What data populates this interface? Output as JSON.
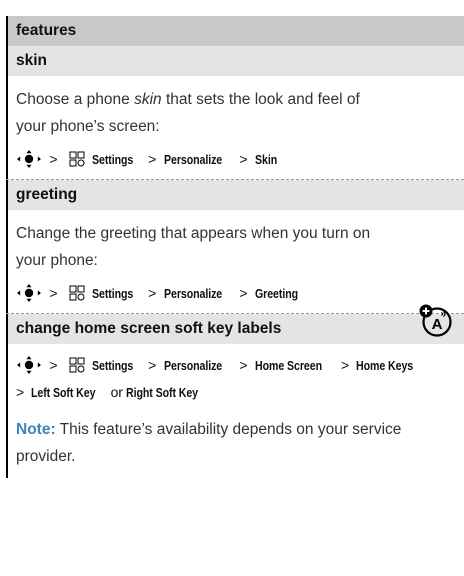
{
  "header": {
    "title": "features"
  },
  "sections": [
    {
      "title": "skin",
      "description_before": "Choose a phone ",
      "description_italic": "skin",
      "description_after": " that sets the look and feel of your phone’s screen:",
      "path": [
        "Settings",
        "Personalize",
        "Skin"
      ]
    },
    {
      "title": "greeting",
      "description": "Change the greeting that appears when you turn on your phone:",
      "path": [
        "Settings",
        "Personalize",
        "Greeting"
      ]
    },
    {
      "title": "change home screen soft key labels",
      "path": [
        "Settings",
        "Personalize",
        "Home Screen",
        "Home Keys",
        "Left Soft Key"
      ],
      "path_join": "or",
      "path_end": "Right Soft Key",
      "note_label": "Note:",
      "note_text": " This feature’s availability depends on your service provider."
    }
  ],
  "separator": ">",
  "icons": [
    "nav-key-icon",
    "settings-icon",
    "network-feature-icon"
  ]
}
